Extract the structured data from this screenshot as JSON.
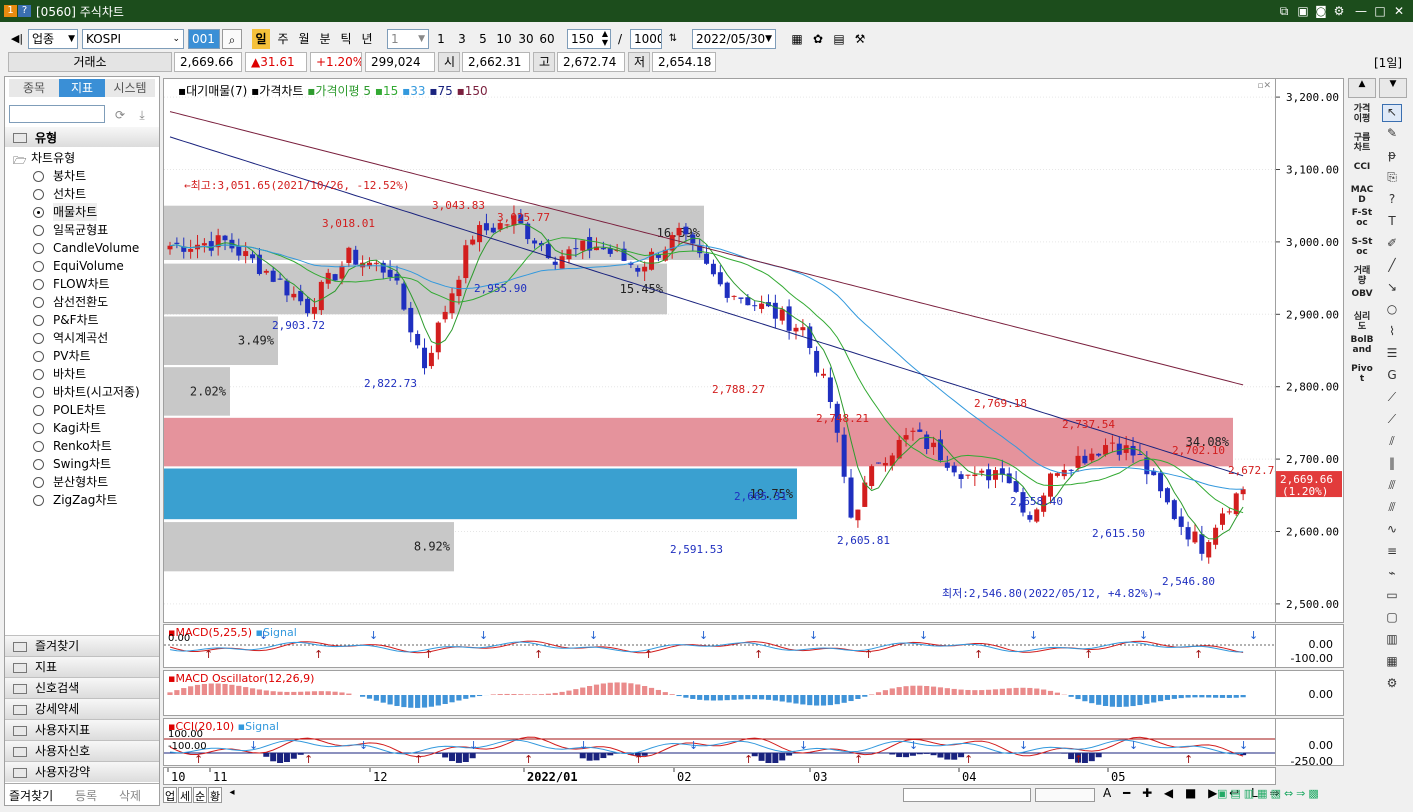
{
  "window": {
    "code": "[0560]",
    "title": "주식차트",
    "app_badges": [
      "1",
      "?"
    ]
  },
  "toolbar": {
    "category": "업종",
    "index_name": "KOSPI",
    "code_input": "001",
    "periods": [
      "일",
      "주",
      "월",
      "분",
      "틱",
      "년"
    ],
    "active_period": "일",
    "minute_select": "1",
    "minute_presets": [
      "1",
      "3",
      "5",
      "10",
      "30",
      "60"
    ],
    "count": "150",
    "total": "1000",
    "date": "2022/05/30"
  },
  "pricebar": {
    "market_label": "거래소",
    "price": "2,669.66",
    "change": "▲31.61",
    "change_pct": "+1.20%",
    "volume": "299,024",
    "open_label": "시",
    "open": "2,662.31",
    "high_label": "고",
    "high": "2,672.74",
    "low_label": "저",
    "low": "2,654.18",
    "period_badge": "[1일]"
  },
  "left": {
    "tabs": [
      "종목",
      "지표",
      "시스템"
    ],
    "active_tab": "지표",
    "section_title": "유형",
    "tree_root": "차트유형",
    "chart_types": [
      "봉차트",
      "선차트",
      "매물차트",
      "일목균형표",
      "CandleVolume",
      "EquiVolume",
      "FLOW차트",
      "삼선전환도",
      "P&F차트",
      "역시계곡선",
      "PV차트",
      "바차트",
      "바차트(시고저종)",
      "POLE차트",
      "Kagi차트",
      "Renko차트",
      "Swing차트",
      "분산형차트",
      "ZigZag차트"
    ],
    "selected": "매물차트",
    "categories": [
      "즐겨찾기",
      "지표",
      "신호검색",
      "강세약세",
      "사용자지표",
      "사용자신호",
      "사용자강약"
    ],
    "bottom_tabs": [
      "즐겨찾기",
      "등록",
      "삭제"
    ]
  },
  "legend": {
    "items": [
      "대기매물(7)",
      "가격차트",
      "가격이평",
      "5",
      "15",
      "33",
      "75",
      "150"
    ],
    "colors": [
      "#000000",
      "#000000",
      "#2e9b2e",
      "#2e9b2e",
      "#33aa33",
      "#3399dd",
      "#1a237e",
      "#7a1f3d"
    ]
  },
  "chart_data": {
    "type": "candlestick",
    "ylim": [
      2475,
      3225
    ],
    "yticks": [
      "3,200.00",
      "3,100.00",
      "3,000.00",
      "2,900.00",
      "2,800.00",
      "2,700.00",
      "2,600.00",
      "2,500.00"
    ],
    "ytick_values": [
      3200,
      3100,
      3000,
      2900,
      2800,
      2700,
      2600,
      2500
    ],
    "xticks": [
      "10",
      "11",
      "12",
      "2022/01",
      "02",
      "03",
      "04",
      "05"
    ],
    "volume_profile": [
      {
        "lo": 2975,
        "hi": 3050,
        "pct": "16.59%"
      },
      {
        "lo": 2900,
        "hi": 2970,
        "pct": "15.45%"
      },
      {
        "lo": 2830,
        "hi": 2897,
        "pct": "3.49%"
      },
      {
        "lo": 2760,
        "hi": 2827,
        "pct": "2.02%"
      },
      {
        "lo": 2690,
        "hi": 2757,
        "pct": "34.08%"
      },
      {
        "lo": 2617,
        "hi": 2687,
        "pct": "19.75%"
      },
      {
        "lo": 2545,
        "hi": 2613,
        "pct": "8.92%"
      }
    ],
    "annotations": {
      "high_note": "←최고:3,051.65(2021/10/26, -12.52%)",
      "low_note": "최저:2,546.80(2022/05/12, +4.82%)→",
      "peaks": [
        "3,018.01",
        "3,043.83",
        "3,025.77",
        "2,788.27",
        "2,748.21",
        "2,769.18",
        "2,737.54",
        "2,702.10",
        "2,672.74"
      ],
      "troughs": [
        "2,903.72",
        "2,822.73",
        "2,955.90",
        "2,591.53",
        "2,665.31",
        "2,605.81",
        "2,658.40",
        "2,615.50",
        "2,546.80"
      ]
    },
    "last_price": "2,669.66",
    "last_pct": "(1.20%)"
  },
  "panels": {
    "macd": {
      "label": "MACD(5,25,5)",
      "signal": "Signal",
      "ticks": [
        "0.00",
        "-100.00"
      ],
      "left": "0.00"
    },
    "osc": {
      "label": "MACD Oscillator(12,26,9)",
      "ticks": [
        "0.00"
      ]
    },
    "cci": {
      "label": "CCI(20,10)",
      "signal": "Signal",
      "ticks": [
        "0.00",
        "-250.00"
      ],
      "left1": "100.00",
      "left2": "-100.00"
    }
  },
  "right_indicators": [
    "가격이평",
    "구름차트",
    "CCI",
    "MACD",
    "F-Stoc",
    "S-Stoc",
    "거래량",
    "OBV",
    "심리도",
    "BolBand",
    "Pivot"
  ],
  "status": {
    "tabs": [
      "업",
      "세",
      "순",
      "황"
    ]
  }
}
